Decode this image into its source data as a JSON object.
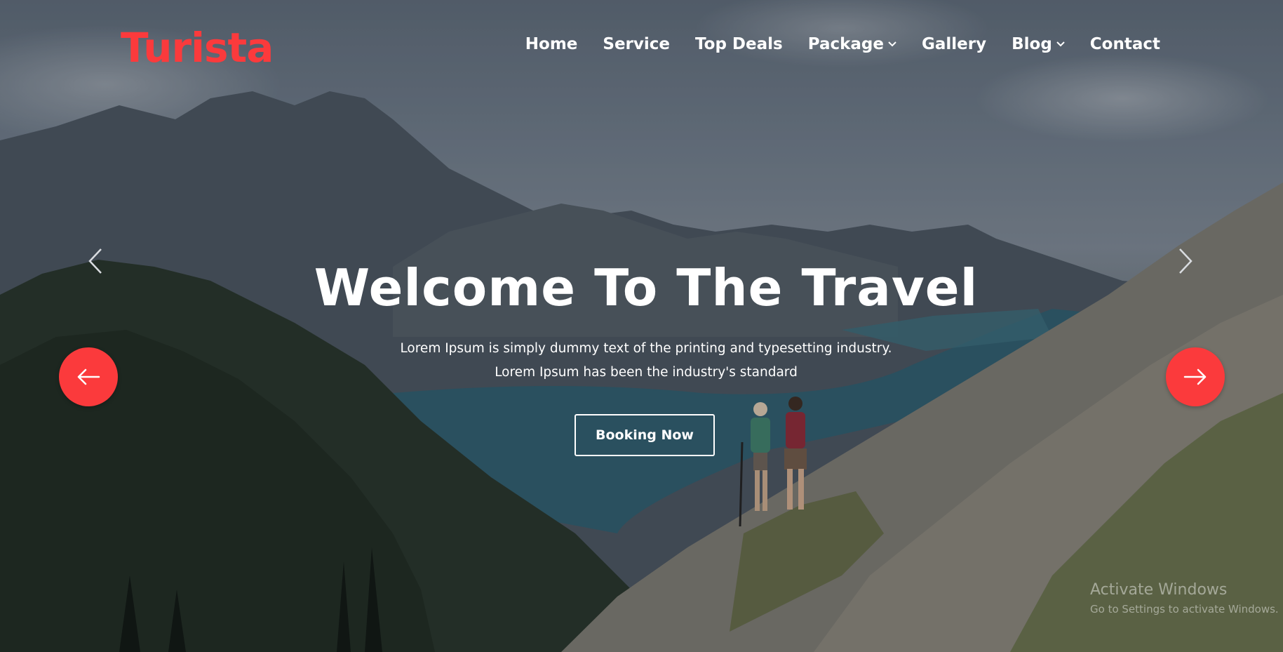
{
  "brand": {
    "logo": "Turista",
    "accent_color": "#fb3a3c"
  },
  "nav": {
    "items": [
      {
        "label": "Home"
      },
      {
        "label": "Service"
      },
      {
        "label": "Top Deals"
      },
      {
        "label": "Package",
        "has_dropdown": true
      },
      {
        "label": "Gallery"
      },
      {
        "label": "Blog",
        "has_dropdown": true
      },
      {
        "label": "Contact"
      }
    ]
  },
  "hero": {
    "title": "Welcome To The Travel",
    "subtitle_line1": "Lorem Ipsum is simply dummy text of the printing and typesetting industry.",
    "subtitle_line2": "Lorem Ipsum has been the industry's standard",
    "cta_label": "Booking Now"
  },
  "icons": {
    "carousel_prev_thin": "chevron-left-icon",
    "carousel_next_thin": "chevron-right-icon",
    "carousel_prev_round": "arrow-left-icon",
    "carousel_next_round": "arrow-right-icon",
    "dropdown": "chevron-down-icon"
  },
  "watermark": {
    "line1": "Activate Windows",
    "line2": "Go to Settings to activate Windows."
  }
}
